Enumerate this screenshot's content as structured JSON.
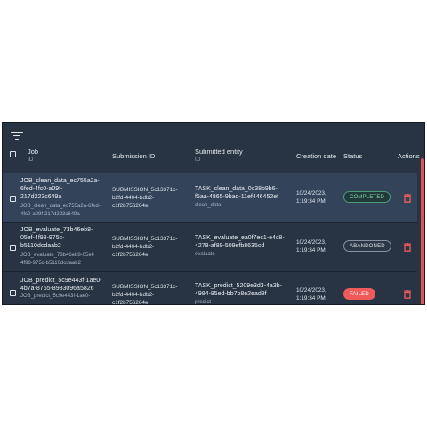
{
  "toolbar": {
    "filter_icon": "filter-icon"
  },
  "table": {
    "headers": {
      "job": "Job",
      "job_sub": "ID",
      "submission": "Submission ID",
      "entity": "Submitted entity",
      "entity_sub": "ID",
      "created": "Creation date",
      "status": "Status",
      "actions": "Actions"
    },
    "rows": [
      {
        "job_name_1": "JOB_clean_data_ec755a2a-",
        "job_name_2": "6fed-4fc0-a09f-",
        "job_name_3": "217d223c649a",
        "job_id_1": "JOB_clean_data_ec755a2a-6fed-",
        "job_id_2": "4fc0-a09f-217d223c649a",
        "sub_1": "SUBMISSION_5c13371c-",
        "sub_2": "b2fd-4404-bdb2-",
        "sub_3": "c1f2b756264e",
        "task_1": "TASK_clean_data_0c38b9b6-",
        "task_2": "f5aa-4865-9bad-11ef446452ef",
        "task_fn": "clean_data",
        "date_1": "10/24/2023,",
        "date_2": "1:19:34 PM",
        "status": "COMPLETED"
      },
      {
        "job_name_1": "JOB_evaluate_73b46eb8-",
        "job_name_2": "05ef-4f98-975c-",
        "job_name_3": "b5110dcdaab2",
        "job_id_1": "JOB_evaluate_73b46eb8-05ef-",
        "job_id_2": "4f98-975c-b5110dcdaab2",
        "sub_1": "SUBMISSION_5c13371c-",
        "sub_2": "b2fd-4404-bdb2-",
        "sub_3": "c1f2b756264e",
        "task_1": "TASK_evaluate_ea0f7ec1-e4c8-",
        "task_2": "4278-af89-509efb8635cd",
        "task_fn": "evaluate",
        "date_1": "10/24/2023,",
        "date_2": "1:19:34 PM",
        "status": "ABANDONED"
      },
      {
        "job_name_1": "JOB_predict_5c9e443f-1ae0-",
        "job_name_2": "4b7a-8755-8933096a5826",
        "job_id_1": "JOB_predict_5c9e443f-1ae0-",
        "sub_1": "SUBMISSION_5c13371c-",
        "sub_2": "b2fd-4404-bdb2-",
        "sub_3": "c1f2b756264e",
        "task_1": "TASK_predict_5209e3d3-4a3b-",
        "task_2": "4984-85ed-bb7b8e2ead8f",
        "task_fn": "predict",
        "date_1": "10/24/2023,",
        "date_2": "1:19:34 PM",
        "status": "FAILED"
      }
    ]
  },
  "colors": {
    "panel_bg": "#283343",
    "selected_row": "#33445a",
    "completed": "#7fd7a8",
    "failed": "#ef5a5a",
    "delete": "#ef5a5a",
    "scrollbar": "#e05353"
  }
}
